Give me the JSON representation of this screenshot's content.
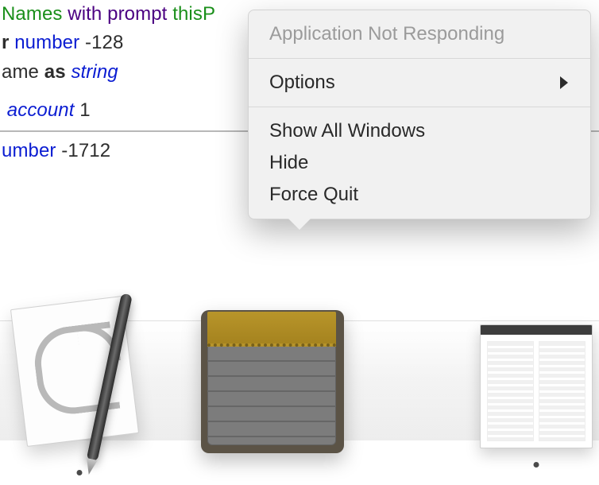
{
  "code": {
    "line1_a": "Names ",
    "line1_b": "with prompt",
    "line1_c": " thisP",
    "line2_a": "r",
    "line2_b": " number",
    "line2_c": " -128",
    "line3_a": "ame ",
    "line3_b": "as",
    "line3_c": " string",
    "line4_a": " account",
    "line4_b": " 1",
    "line5_a": "umber",
    "line5_b": " -1712"
  },
  "menu": {
    "not_responding": "Application Not Responding",
    "options": "Options",
    "show_all": "Show All Windows",
    "hide": "Hide",
    "force_quit": "Force Quit"
  },
  "dock": {
    "items": [
      {
        "name": "script-editor",
        "running": true
      },
      {
        "name": "notes",
        "running": false
      },
      {
        "name": "preview-document",
        "running": true
      }
    ]
  }
}
